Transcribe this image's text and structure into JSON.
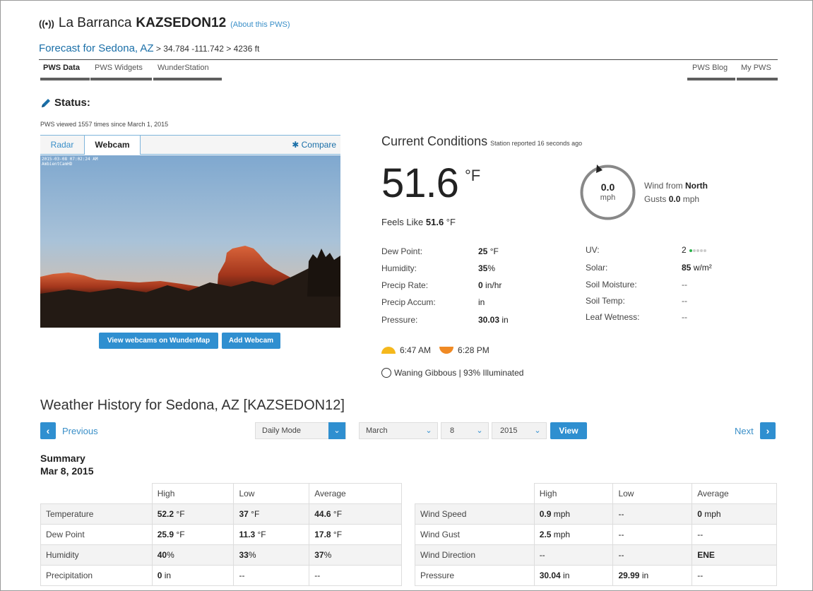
{
  "header": {
    "wifi_glyph": "((•))",
    "station_name": "La Barranca",
    "station_id": "KAZSEDON12",
    "about_link": "(About this PWS)"
  },
  "forecast": {
    "link": "Forecast for Sedona, AZ",
    "coords": " > 34.784 -111.742 > 4236 ft"
  },
  "nav": {
    "left": [
      "PWS Data",
      "PWS Widgets",
      "WunderStation"
    ],
    "right": [
      "PWS Blog",
      "My PWS"
    ]
  },
  "status": {
    "title": "Status:",
    "viewed": "PWS viewed 1557 times since March 1, 2015"
  },
  "media": {
    "tab_radar": "Radar",
    "tab_webcam": "Webcam",
    "compare": "Compare",
    "stamp_line1": "2015-03-08 07:02:24 AM",
    "stamp_line2": "AmbientCamHD",
    "btn_view_webcams": "View webcams on WunderMap",
    "btn_add_webcam": "Add Webcam"
  },
  "current": {
    "title": "Current Conditions",
    "reported": "Station reported 16 seconds ago",
    "temperature": "51.6",
    "temp_unit": "°F",
    "feels_label": "Feels Like ",
    "feels_value": "51.6",
    "feels_unit": " °F",
    "wind_speed": "0.0",
    "wind_unit": "mph",
    "wind_from_label": "Wind from ",
    "wind_from_value": "North",
    "gusts_label": "Gusts ",
    "gusts_value": "0.0",
    "gusts_unit": " mph",
    "left_rows": [
      {
        "label": "Dew Point:",
        "value": "25",
        "unit": " °F"
      },
      {
        "label": "Humidity:",
        "value": "35",
        "unit": "%"
      },
      {
        "label": "Precip Rate:",
        "value": "0",
        "unit": " in/hr"
      },
      {
        "label": "Precip Accum:",
        "value": "",
        "unit": "in"
      },
      {
        "label": "Pressure:",
        "value": "30.03",
        "unit": " in"
      }
    ],
    "right_rows": [
      {
        "label": "UV:",
        "value": "",
        "unit": "2"
      },
      {
        "label": "Solar:",
        "value": "85",
        "unit": " w/m²"
      },
      {
        "label": "Soil Moisture:",
        "value": "",
        "unit": "--"
      },
      {
        "label": "Soil Temp:",
        "value": "",
        "unit": "--"
      },
      {
        "label": "Leaf Wetness:",
        "value": "",
        "unit": "--"
      }
    ],
    "uv_level": 1,
    "uv_max": 5,
    "sunrise": "6:47 AM",
    "sunset": "6:28 PM",
    "moon": "Waning Gibbous | 93% Illuminated"
  },
  "history": {
    "title": "Weather History for Sedona, AZ [KAZSEDON12]",
    "previous": "Previous",
    "next": "Next",
    "mode": "Daily Mode",
    "month": "March",
    "day": "8",
    "year": "2015",
    "view_btn": "View",
    "summary_label": "Summary",
    "summary_date": "Mar 8, 2015",
    "headers": [
      "High",
      "Low",
      "Average"
    ],
    "left_table": [
      {
        "label": "Temperature",
        "high": "52.2",
        "high_u": " °F",
        "low": "37",
        "low_u": " °F",
        "avg": "44.6",
        "avg_u": " °F"
      },
      {
        "label": "Dew Point",
        "high": "25.9",
        "high_u": " °F",
        "low": "11.3",
        "low_u": " °F",
        "avg": "17.8",
        "avg_u": " °F"
      },
      {
        "label": "Humidity",
        "high": "40",
        "high_u": "%",
        "low": "33",
        "low_u": "%",
        "avg": "37",
        "avg_u": "%"
      },
      {
        "label": "Precipitation",
        "high": "0",
        "high_u": " in",
        "low": "",
        "low_u": "--",
        "avg": "",
        "avg_u": "--"
      }
    ],
    "right_table": [
      {
        "label": "Wind Speed",
        "high": "0.9",
        "high_u": " mph",
        "low": "",
        "low_u": "--",
        "avg": "0",
        "avg_u": " mph"
      },
      {
        "label": "Wind Gust",
        "high": "2.5",
        "high_u": " mph",
        "low": "",
        "low_u": "--",
        "avg": "",
        "avg_u": "--"
      },
      {
        "label": "Wind Direction",
        "high": "",
        "high_u": "--",
        "low": "",
        "low_u": "--",
        "avg": "ENE",
        "avg_u": ""
      },
      {
        "label": "Pressure",
        "high": "30.04",
        "high_u": " in",
        "low": "29.99",
        "low_u": " in",
        "avg": "",
        "avg_u": "--"
      }
    ]
  },
  "colors": {
    "link_blue": "#3a8fc8",
    "button_blue": "#2f8fd0",
    "uv_green": "#2bb34b",
    "sunrise": "#f5b81c",
    "sunset": "#f08a24"
  }
}
